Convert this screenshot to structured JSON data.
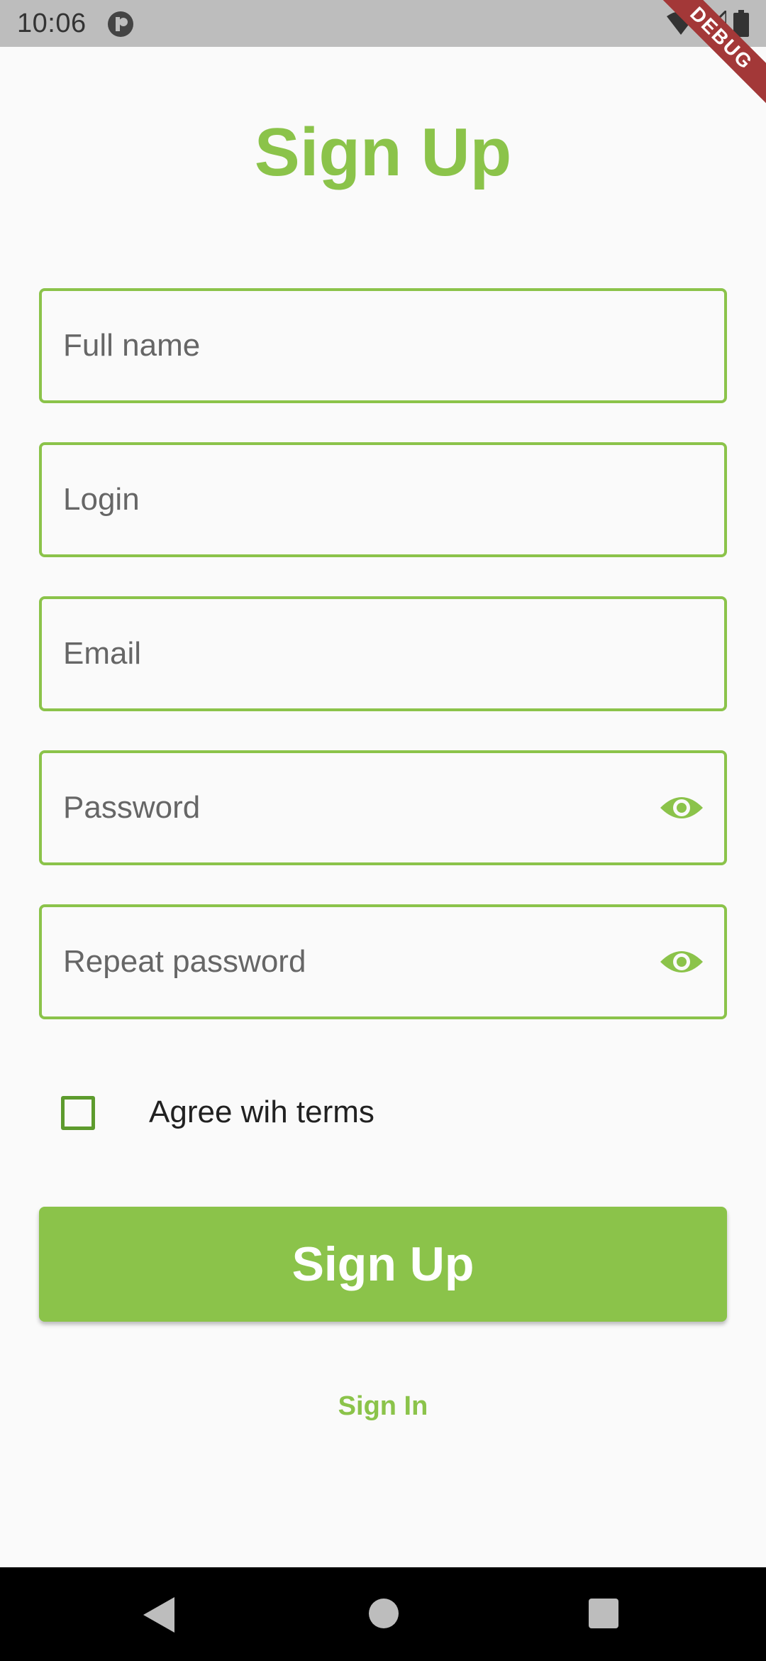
{
  "status_bar": {
    "time": "10:06",
    "debug_banner": "DEBUG",
    "icons": [
      "app-notification-icon",
      "wifi-icon",
      "signal-icon",
      "battery-icon"
    ]
  },
  "title": "Sign Up",
  "fields": {
    "full_name": {
      "placeholder": "Full name",
      "value": ""
    },
    "login": {
      "placeholder": "Login",
      "value": ""
    },
    "email": {
      "placeholder": "Email",
      "value": ""
    },
    "password": {
      "placeholder": "Password",
      "value": ""
    },
    "repeat_password": {
      "placeholder": "Repeat password",
      "value": ""
    }
  },
  "terms": {
    "label": "Agree wih terms",
    "checked": false
  },
  "signup_button": {
    "label": "Sign Up"
  },
  "signin_link": {
    "label": "Sign In"
  },
  "colors": {
    "accent": "#8bc34a",
    "checkbox_border": "#5d9b2d",
    "background": "#fafafa",
    "status_bar": "#bdbdbd",
    "nav_bar": "#000000",
    "debug_ribbon": "#a33838"
  },
  "nav": [
    "back-icon",
    "home-icon",
    "recents-icon"
  ]
}
